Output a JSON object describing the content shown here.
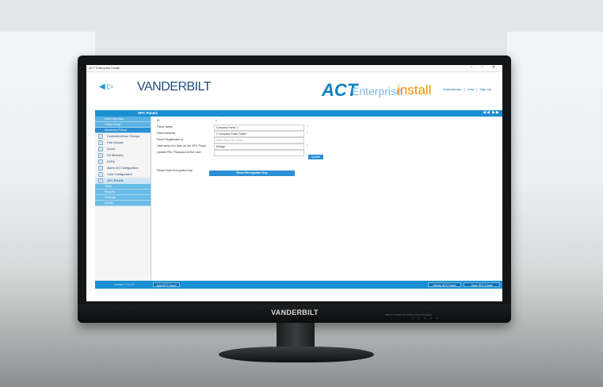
{
  "window": {
    "title": "ACT Enterprise Install",
    "controls": "– ▫ ✕"
  },
  "header": {
    "nav_arrows": "◀ ▷",
    "brand_logo": "VANDERBILT",
    "product_act": "ACT",
    "product_enterprise": "Enterprise",
    "product_install": "install",
    "links": [
      "Administrator",
      "|",
      "Help",
      "|",
      "Sign out"
    ]
  },
  "titlebar": {
    "title": "SPC Panels",
    "pager": "◀◀ ▶▶"
  },
  "sidebar": {
    "sections": [
      {
        "label": "User Operator"
      },
      {
        "label": "Visitor Mngt"
      },
      {
        "label": "Advanced Setup",
        "active": true
      }
    ],
    "items": [
      {
        "label": "Controllers/Door Groups",
        "icon": "controller-groups-icon"
      },
      {
        "label": "Hub Groups",
        "icon": "hub-groups-icon"
      },
      {
        "label": "Doors",
        "icon": "door-icon"
      },
      {
        "label": "I/O Modules",
        "icon": "io-module-icon"
      },
      {
        "label": "DVRs",
        "icon": "dvr-icon"
      },
      {
        "label": "Alarm I/O Configuration",
        "icon": "alarm-config-icon"
      },
      {
        "label": "Card Configuration",
        "icon": "card-config-icon"
      },
      {
        "label": "SPC Panels",
        "icon": "spc-panel-icon",
        "selected": true
      }
    ],
    "sections_after": [
      {
        "label": "Tools"
      },
      {
        "label": "Reports"
      },
      {
        "label": "Settings"
      },
      {
        "label": "Admin"
      }
    ],
    "version": "Version 7.0.4.10"
  },
  "form": {
    "rows": [
      {
        "label": "ID",
        "value": "1",
        "placeholder": false,
        "required": false
      },
      {
        "label": "Panel Name",
        "value": "Company Panel 1",
        "placeholder": false,
        "required": true
      },
      {
        "label": "Panel Address",
        "value": "1 Company Road, Dublin",
        "placeholder": false,
        "required": true
      },
      {
        "label": "Panel Registration Id",
        "value": "Enter Panel ID number",
        "placeholder": true,
        "required": false
      },
      {
        "label": "Username of a User on the SPC Panel",
        "value": "Mmagn",
        "placeholder": false,
        "required": true
      },
      {
        "label": "Update PIN / Password of the User",
        "value": "",
        "placeholder": false,
        "required": false
      }
    ],
    "update_label": "Update",
    "reset_label": "Reset Panel Encryption Key",
    "reset_button_label": "Reset Encryption Key"
  },
  "footer": {
    "add_label": "Add SPC Panel",
    "delete_label": "Delete SPC Panel",
    "save_label": "Save SPC Panel"
  },
  "monitor": {
    "bezel_logo": "VANDERBILT",
    "bezel_buttons": "MENU   POWER   UP   DOWN   AUTO   SOURCE"
  },
  "colors": {
    "accent_blue": "#1b8fd2",
    "brand_navy": "#1e4b7b",
    "install_orange": "#f39100"
  }
}
